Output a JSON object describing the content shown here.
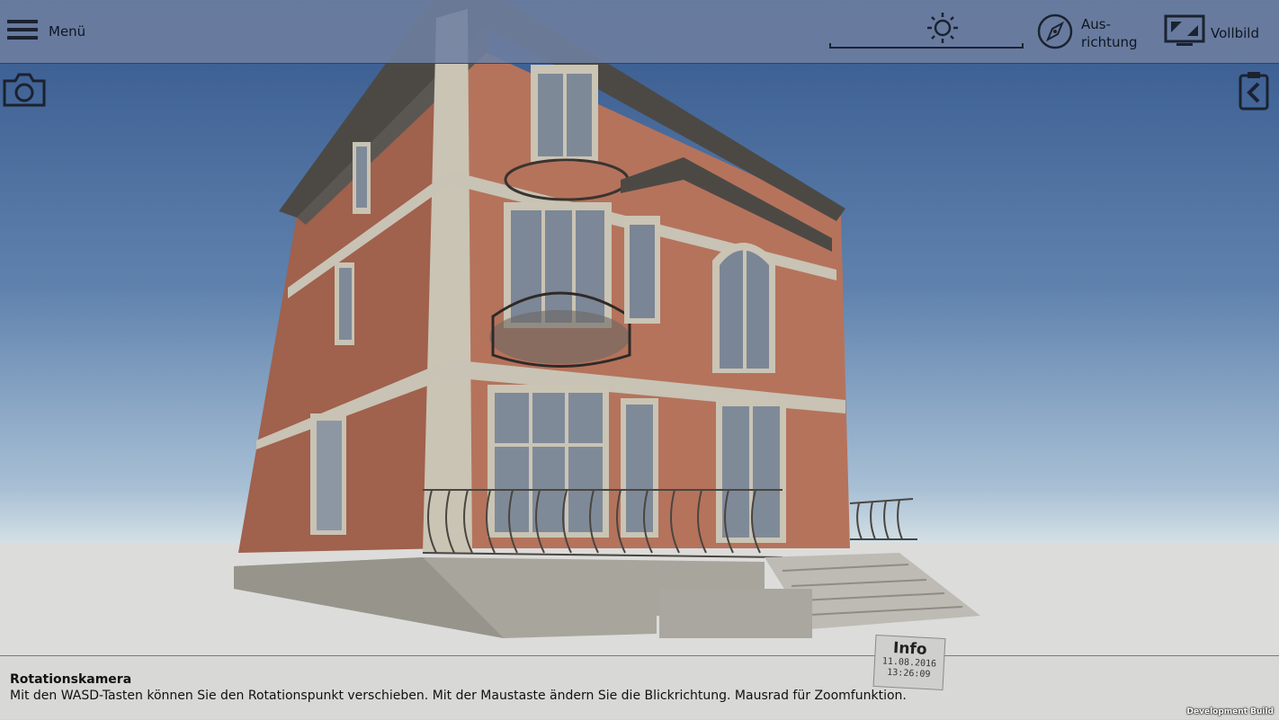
{
  "topbar": {
    "menu_label": "Menü",
    "orientation_label": "Aus-\nrichtung",
    "fullscreen_label": "Vollbild"
  },
  "viewport": {
    "sun_icon": "sun-icon",
    "camera_icon": "camera-icon",
    "collapse_icon": "clipboard-back-icon"
  },
  "info_tag": {
    "label": "Info",
    "date": "11.08.2016",
    "time": "13:26:09"
  },
  "infobar": {
    "title": "Rotationskamera",
    "description": "Mit den WASD-Tasten können Sie den Rotationspunkt verschieben. Mit der Maustaste ändern Sie die Blickrichtung. Mausrad für Zoomfunktion.",
    "build_label": "Development Build"
  },
  "colors": {
    "wall": "#b5735c",
    "trim": "#c8c3b4",
    "roof": "#4c4945",
    "sky": "#35578d",
    "ground": "#d8d8d6"
  }
}
